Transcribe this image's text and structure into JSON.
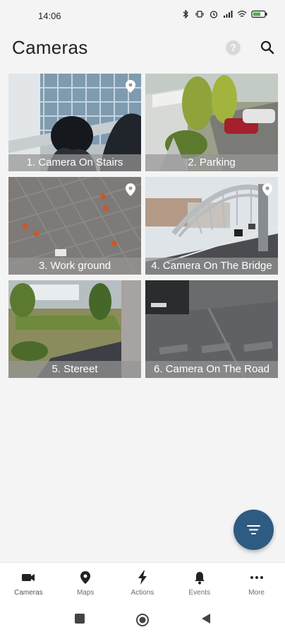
{
  "status_bar": {
    "time": "14:06",
    "icons": [
      "sim-icon",
      "sim-icon",
      "bluetooth-icon",
      "vibrate-icon",
      "alarm-icon",
      "signal-icon",
      "wifi-icon",
      "battery-icon"
    ]
  },
  "header": {
    "title": "Cameras",
    "help_icon": "help-icon",
    "search_icon": "search-icon"
  },
  "cameras": [
    {
      "label": "1. Camera On Stairs",
      "has_pin": true
    },
    {
      "label": "2. Parking",
      "has_pin": false
    },
    {
      "label": "3. Work ground",
      "has_pin": true
    },
    {
      "label": "4. Camera On The Bridge",
      "has_pin": true
    },
    {
      "label": "5. Stereet",
      "has_pin": false
    },
    {
      "label": "6. Camera On The Road",
      "has_pin": false
    }
  ],
  "fab": {
    "icon": "filter-icon"
  },
  "bottom_nav": {
    "items": [
      {
        "label": "Cameras",
        "icon": "camera-icon",
        "active": true
      },
      {
        "label": "Maps",
        "icon": "map-pin-icon",
        "active": false
      },
      {
        "label": "Actions",
        "icon": "lightning-icon",
        "active": false
      },
      {
        "label": "Events",
        "icon": "bell-icon",
        "active": false
      },
      {
        "label": "More",
        "icon": "more-icon",
        "active": false
      }
    ]
  },
  "system_nav": [
    "recents-button",
    "home-button",
    "back-button"
  ],
  "colors": {
    "accent": "#2e5b82",
    "background": "#f4f4f4"
  }
}
